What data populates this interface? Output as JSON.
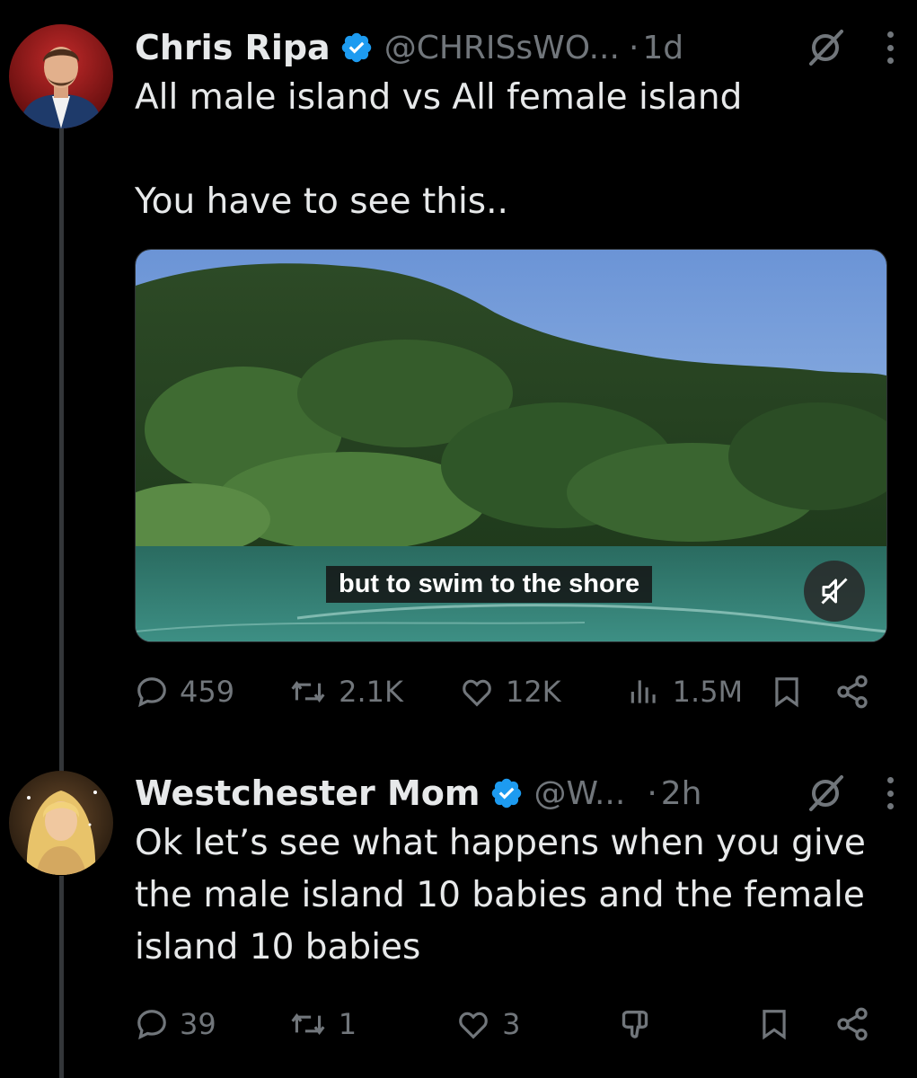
{
  "tweets": [
    {
      "name": "Chris Ripa",
      "handle": "@CHRISsWO...",
      "dot": "·",
      "time": "1d",
      "text_lines": [
        "All male island vs All female island",
        "",
        "You have to see this.."
      ],
      "video_caption": "but to swim to the shore",
      "replies": "459",
      "reposts": "2.1K",
      "likes": "12K",
      "views": "1.5M"
    },
    {
      "name": "Westchester Mom",
      "handle": "@W...",
      "dot": "·",
      "time": "2h",
      "text_lines": [
        "Ok let’s see what happens when you give",
        "the male island 10 babies and the female",
        "island 10 babies"
      ],
      "replies": "39",
      "reposts": "1",
      "likes": "3"
    }
  ],
  "colors": {
    "background": "#000000",
    "text": "#e7e9ea",
    "muted": "#71767b",
    "verified": "#1d9bf0"
  },
  "icons": [
    "verified-badge-icon",
    "grok-icon",
    "more-icon",
    "mute-icon",
    "reply-icon",
    "repost-icon",
    "like-icon",
    "views-icon",
    "bookmark-icon",
    "share-icon",
    "downvote-icon"
  ]
}
